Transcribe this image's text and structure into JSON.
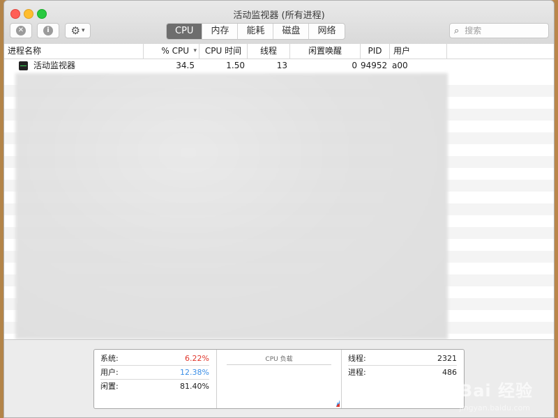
{
  "window": {
    "title": "活动监视器 (所有进程)"
  },
  "toolbar": {
    "tabs": [
      {
        "label": "CPU",
        "active": true
      },
      {
        "label": "内存"
      },
      {
        "label": "能耗"
      },
      {
        "label": "磁盘"
      },
      {
        "label": "网络"
      }
    ],
    "search_placeholder": "搜索"
  },
  "table": {
    "columns": [
      "进程名称",
      "% CPU",
      "CPU 时间",
      "线程",
      "闲置唤醒",
      "PID",
      "用户"
    ],
    "rows": [
      {
        "name": "活动监视器",
        "cpu": "34.5",
        "cpu_time": "1.50",
        "threads": "13",
        "idle_wake": "0",
        "pid": "94952",
        "user": "a00"
      }
    ]
  },
  "summary": {
    "system_label": "系统:",
    "system_value": "6.22%",
    "user_label": "用户:",
    "user_value": "12.38%",
    "idle_label": "闲置:",
    "idle_value": "81.40%",
    "cpu_load_title": "CPU 负载",
    "threads_label": "线程:",
    "threads_value": "2321",
    "processes_label": "进程:",
    "processes_value": "486"
  },
  "colors": {
    "system": "#e0352b",
    "user": "#3a8ee6"
  },
  "watermark": {
    "text": "Bai 经验",
    "subtext": "jingyan.baidu.com"
  }
}
